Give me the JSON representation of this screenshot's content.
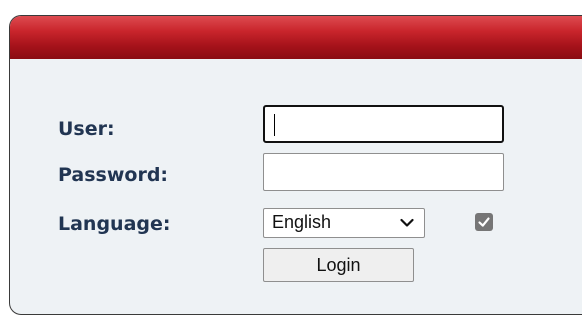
{
  "login_form": {
    "user_label": "User:",
    "user_value": "",
    "password_label": "Password:",
    "password_value": "",
    "language_label": "Language:",
    "language_selected": "English",
    "language_options": [
      "English"
    ],
    "remember_checked": true,
    "login_label": "Login"
  },
  "icons": {
    "dropdown": "chevron-down-icon",
    "checkbox": "checkmark-icon"
  },
  "colors": {
    "header_red": "#c9252c",
    "panel_background": "#eef2f5",
    "label_text": "#213552"
  }
}
